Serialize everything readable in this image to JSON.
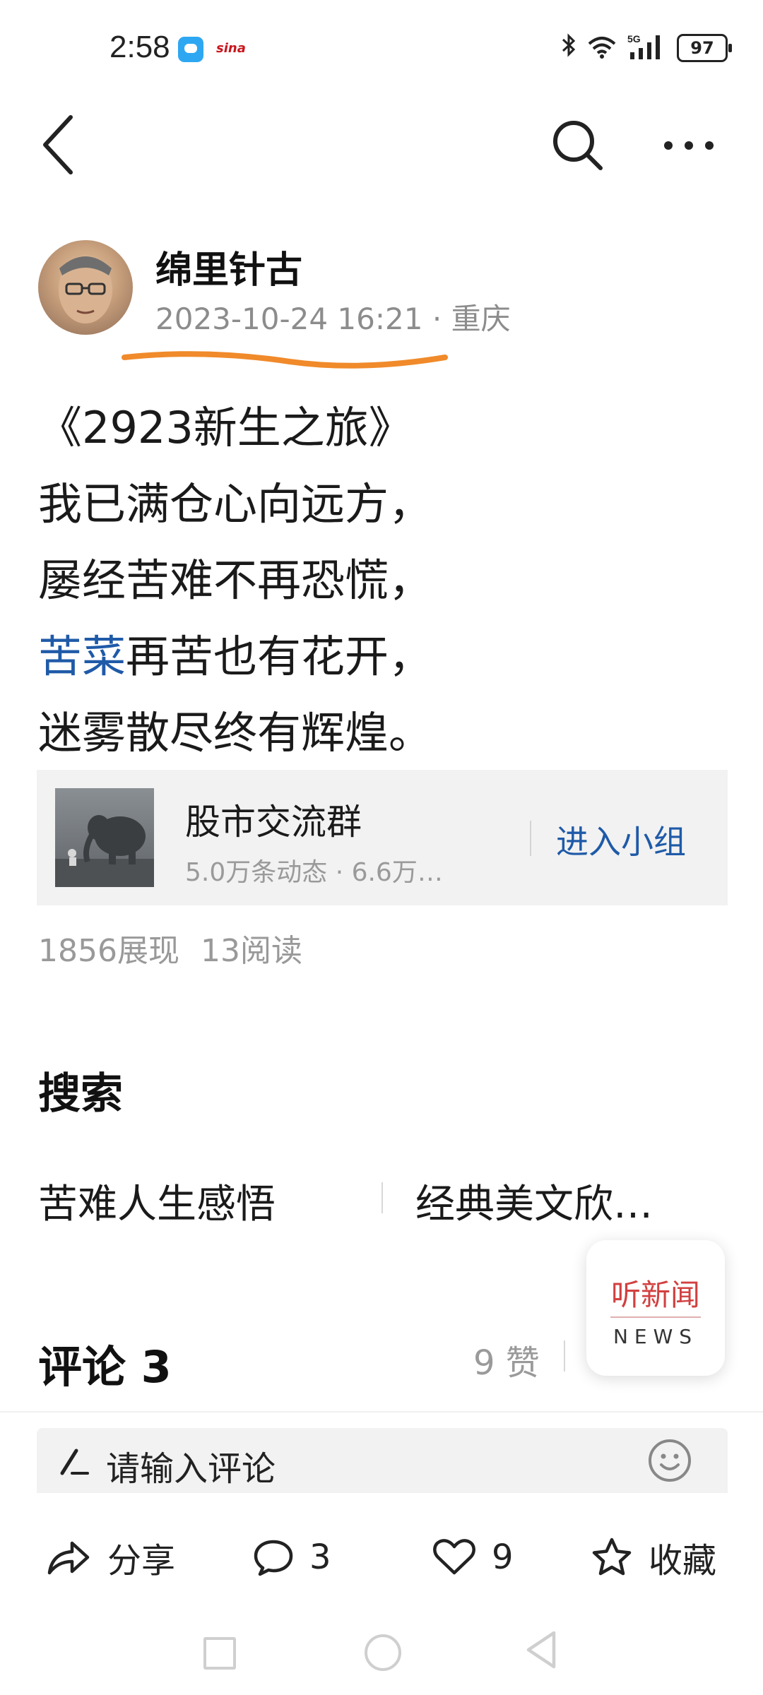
{
  "status_bar": {
    "time": "2:58",
    "battery": "97",
    "sina_label": "sina",
    "network_label": "5G",
    "icons": [
      "message-icon",
      "sina-icon",
      "bluetooth-icon",
      "wifi-icon",
      "signal-icon",
      "battery-icon"
    ]
  },
  "nav": {
    "icons": [
      "back-icon",
      "search-icon",
      "more-icon"
    ]
  },
  "post": {
    "author": "绵里针古",
    "datetime": "2023-10-24 16:21",
    "location_sep": "·",
    "location": "重庆",
    "lines": [
      {
        "text": "《2923新生之旅》"
      },
      {
        "text": "我已满仓心向远方，"
      },
      {
        "text": "屡经苦难不再恐慌，"
      },
      {
        "link": "苦菜",
        "text": "再苦也有花开，"
      },
      {
        "text": "迷雾散尽终有辉煌。"
      }
    ]
  },
  "group": {
    "name": "股市交流群",
    "stats": "5.0万条动态 · 6.6万…",
    "join_label": "进入小组"
  },
  "stats": {
    "views": "1856展现",
    "reads": "13阅读"
  },
  "search": {
    "title": "搜索",
    "items": [
      "苦难人生感悟",
      "经典美文欣…"
    ]
  },
  "comments": {
    "title": "评论 3",
    "likes": "9 赞",
    "input_placeholder": "请输入评论"
  },
  "news_fab": {
    "cn": "听新闻",
    "en": "NEWS"
  },
  "actions": {
    "share": "分享",
    "comment_count": "3",
    "like_count": "9",
    "collect": "收藏"
  },
  "colors": {
    "accent_blue": "#1f5aa8",
    "underline_orange": "#f08a2a",
    "news_red": "#d24040"
  }
}
